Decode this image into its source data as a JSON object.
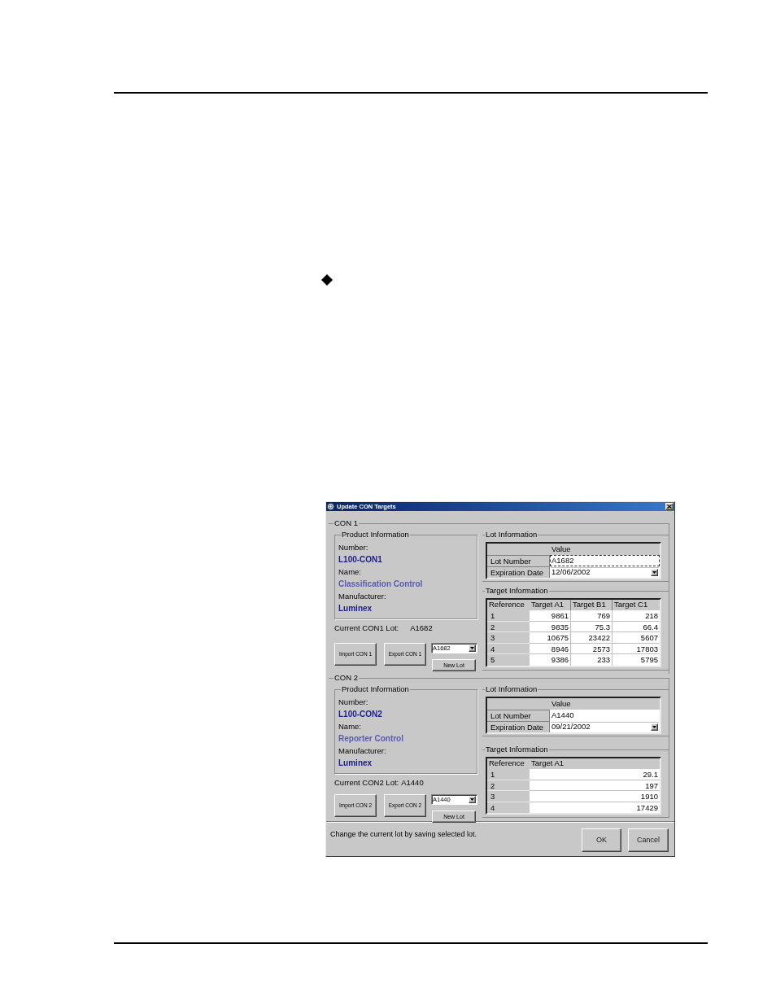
{
  "dialog": {
    "title": "Update CON Targets",
    "groups": [
      {
        "label": "CON 1",
        "product_information": {
          "label": "Product Information",
          "fields": [
            {
              "label": "Number:",
              "value": "L100-CON1"
            },
            {
              "label": "Name:",
              "value": "Classification Control"
            },
            {
              "label": "Manufacturer:",
              "value": "Luminex"
            }
          ]
        },
        "current_lot": {
          "label": "Current CON1 Lot:",
          "value": "A1682"
        },
        "import_button": "Import CON 1",
        "export_button": "Export CON 1",
        "lot_dropdown": "A1682",
        "new_lot_button": "New Lot",
        "lot_information": {
          "label": "Lot Information",
          "header": "Value",
          "rows": [
            {
              "kind": "text",
              "label": "Lot Number",
              "value": "A1682",
              "focused": true
            },
            {
              "kind": "dropdown",
              "label": "Expiration Date",
              "value": "12/06/2002",
              "focused": false
            }
          ]
        },
        "target_information": {
          "label": "Target Information",
          "columns": [
            "Reference",
            "Target A1",
            "Target B1",
            "Target C1"
          ],
          "rows": [
            [
              "1",
              "9861",
              "769",
              "218"
            ],
            [
              "2",
              "9835",
              "75.3",
              "66.4"
            ],
            [
              "3",
              "10675",
              "23422",
              "5607"
            ],
            [
              "4",
              "8946",
              "2573",
              "17803"
            ],
            [
              "5",
              "9386",
              "233",
              "5795"
            ]
          ]
        }
      },
      {
        "label": "CON 2",
        "product_information": {
          "label": "Product Information",
          "fields": [
            {
              "label": "Number:",
              "value": "L100-CON2"
            },
            {
              "label": "Name:",
              "value": "Reporter Control"
            },
            {
              "label": "Manufacturer:",
              "value": "Luminex"
            }
          ]
        },
        "current_lot": {
          "label": "Current CON2 Lot:",
          "value": "A1440"
        },
        "import_button": "Import CON 2",
        "export_button": "Export CON 2",
        "lot_dropdown": "A1440",
        "new_lot_button": "New Lot",
        "lot_information": {
          "label": "Lot Information",
          "header": "Value",
          "rows": [
            {
              "kind": "text",
              "label": "Lot Number",
              "value": "A1440",
              "focused": false
            },
            {
              "kind": "dropdown",
              "label": "Expiration Date",
              "value": "09/21/2002",
              "focused": false
            }
          ]
        },
        "target_information": {
          "label": "Target Information",
          "columns": [
            "Reference",
            "Target A1"
          ],
          "rows": [
            [
              "1",
              "29.1"
            ],
            [
              "2",
              "197"
            ],
            [
              "3",
              "1910"
            ],
            [
              "4",
              "17429"
            ]
          ]
        }
      }
    ],
    "status_text": "Change the current lot by saving selected lot.",
    "buttons": [
      "OK",
      "Cancel"
    ]
  }
}
